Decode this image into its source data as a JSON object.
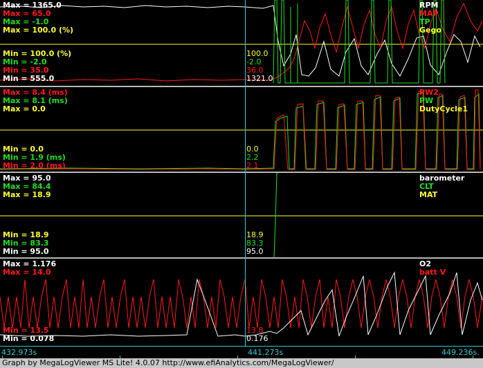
{
  "panes": [
    {
      "left_max": [
        {
          "text": "Max = 1365.0",
          "color": "w"
        },
        {
          "text": "Max = 65.0",
          "color": "r"
        },
        {
          "text": "Max = -1.0",
          "color": "g"
        },
        {
          "text": "Max = 100.0 (%)",
          "color": "y"
        }
      ],
      "left_min": [
        {
          "text": "Min = 100.0 (%)",
          "color": "y"
        },
        {
          "text": "Min = -2.0",
          "color": "g"
        },
        {
          "text": "Min = 35.0",
          "color": "r"
        },
        {
          "text": "Min = 555.0",
          "color": "w"
        }
      ],
      "right_legend": [
        {
          "text": "RPM",
          "color": "w"
        },
        {
          "text": "MAP",
          "color": "r"
        },
        {
          "text": "TP",
          "color": "g"
        },
        {
          "text": "Gego",
          "color": "y"
        }
      ],
      "cursor_values": [
        {
          "text": "100.0",
          "color": "y"
        },
        {
          "text": "-2.0",
          "color": "g"
        },
        {
          "text": "36.0",
          "color": "r"
        },
        {
          "text": "1321.0",
          "color": "w"
        }
      ]
    },
    {
      "left_max": [
        {
          "text": "Max = 8.4 (ms)",
          "color": "r"
        },
        {
          "text": "Max = 8.1 (ms)",
          "color": "g"
        },
        {
          "text": "Max = 0.0",
          "color": "y"
        }
      ],
      "left_min": [
        {
          "text": "Min = 0.0",
          "color": "y"
        },
        {
          "text": "Min = 1.9 (ms)",
          "color": "g"
        },
        {
          "text": "Min = 2.0 (ms)",
          "color": "r"
        }
      ],
      "right_legend": [
        {
          "text": "PW2",
          "color": "r"
        },
        {
          "text": "PW",
          "color": "g"
        },
        {
          "text": "DutyCycle1",
          "color": "y"
        }
      ],
      "cursor_values": [
        {
          "text": "0.0",
          "color": "y"
        },
        {
          "text": "2.2",
          "color": "g"
        },
        {
          "text": "2.1",
          "color": "r"
        }
      ]
    },
    {
      "left_max": [
        {
          "text": "Max = 95.0",
          "color": "w"
        },
        {
          "text": "Max = 84.4",
          "color": "g"
        },
        {
          "text": "Max = 18.9",
          "color": "y"
        }
      ],
      "left_min": [
        {
          "text": "Min = 18.9",
          "color": "y"
        },
        {
          "text": "Min = 83.3",
          "color": "g"
        },
        {
          "text": "Min = 95.0",
          "color": "w"
        }
      ],
      "right_legend": [
        {
          "text": "barometer",
          "color": "w"
        },
        {
          "text": "CLT",
          "color": "g"
        },
        {
          "text": "MAT",
          "color": "y"
        }
      ],
      "cursor_values": [
        {
          "text": "18.9",
          "color": "y"
        },
        {
          "text": "83.3",
          "color": "g"
        },
        {
          "text": "95.0",
          "color": "w"
        }
      ]
    },
    {
      "left_max": [
        {
          "text": "Max = 1.176",
          "color": "w"
        },
        {
          "text": "Max = 14.0",
          "color": "r"
        }
      ],
      "left_min": [
        {
          "text": "Min = 13.5",
          "color": "r"
        },
        {
          "text": "Min = 0.078",
          "color": "w"
        }
      ],
      "right_legend": [
        {
          "text": "O2",
          "color": "w"
        },
        {
          "text": "batt V",
          "color": "r"
        }
      ],
      "cursor_values": [
        {
          "text": "13.8",
          "color": "r"
        },
        {
          "text": "0.176",
          "color": "w"
        }
      ]
    }
  ],
  "time_axis": {
    "start": "432.973s",
    "cursor": "441.273s",
    "end": "449.236s."
  },
  "footer": "Graph by MegaLogViewer MS Lite! 4.0.07 http://www.efiAnalytics.com/MegaLogViewer/",
  "colors": {
    "w": "#ffffff",
    "r": "#ff1a1a",
    "g": "#22e022",
    "y": "#ffff33",
    "cursor": "#33cccc"
  }
}
